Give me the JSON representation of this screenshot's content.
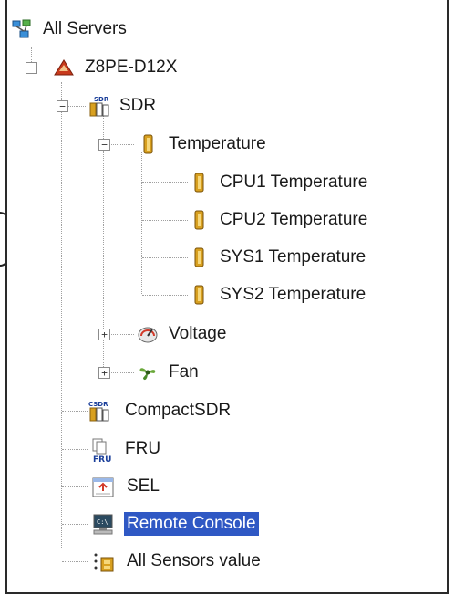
{
  "tree": {
    "root": {
      "label": "All Servers"
    },
    "server": {
      "label": "Z8PE-D12X",
      "expander": "−"
    },
    "sdr": {
      "label": "SDR",
      "icon_tag": "SDR",
      "expander": "−"
    },
    "temperature": {
      "label": "Temperature",
      "expander": "−",
      "children": [
        "CPU1 Temperature",
        "CPU2 Temperature",
        "SYS1 Temperature",
        "SYS2 Temperature"
      ]
    },
    "voltage": {
      "label": "Voltage",
      "expander": "+"
    },
    "fan": {
      "label": "Fan",
      "expander": "+"
    },
    "compact_sdr": {
      "label": "CompactSDR",
      "icon_tag": "CSDR"
    },
    "fru": {
      "label": "FRU",
      "icon_tag": "FRU"
    },
    "sel": {
      "label": "SEL"
    },
    "remote_console": {
      "label": "Remote Console",
      "icon_tag": "C:\\",
      "selected": true
    },
    "all_sensors": {
      "label": "All Sensors value"
    }
  },
  "colors": {
    "selection": "#2f58c4",
    "sensor_icon": "#d8a020",
    "server_icon": "#c83a1c",
    "fan_icon": "#6aa83a"
  }
}
